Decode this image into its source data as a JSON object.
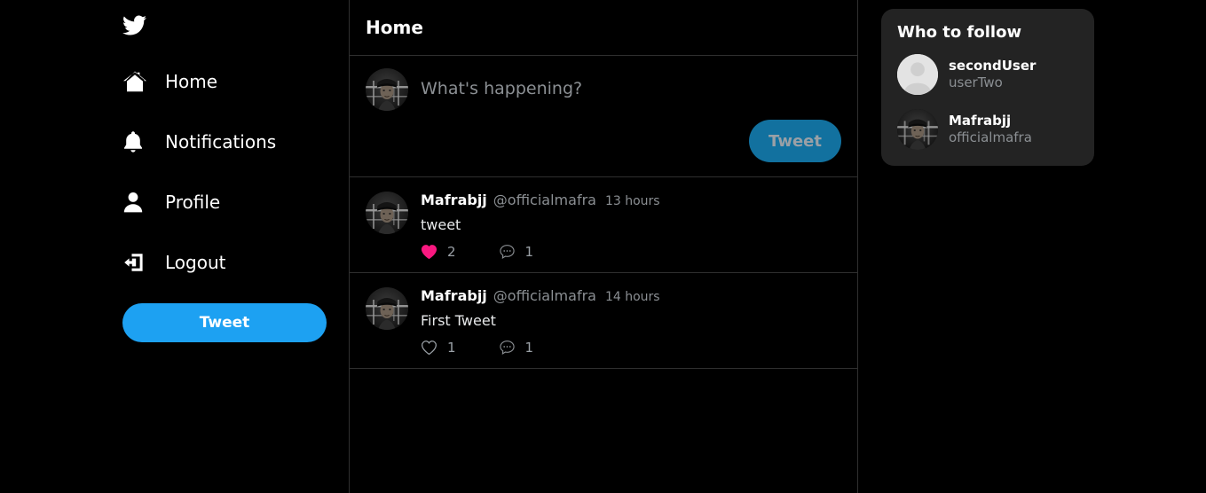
{
  "brand": {
    "logo_icon": "twitter-bird-icon"
  },
  "sidebar": {
    "items": [
      {
        "label": "Home",
        "icon": "home-icon"
      },
      {
        "label": "Notifications",
        "icon": "bell-icon"
      },
      {
        "label": "Profile",
        "icon": "person-icon"
      },
      {
        "label": "Logout",
        "icon": "logout-icon"
      }
    ],
    "tweet_button": "Tweet"
  },
  "feed": {
    "title": "Home",
    "composer": {
      "placeholder": "What's happening?",
      "value": "",
      "submit_label": "Tweet",
      "avatar_icon": "user-avatar-photo"
    },
    "tweets": [
      {
        "name": "Mafrabjj",
        "handle": "@officialmafra",
        "time": "13 hours",
        "text": "tweet",
        "like_count": "2",
        "liked": true,
        "comment_count": "1",
        "avatar_icon": "user-avatar-photo"
      },
      {
        "name": "Mafrabjj",
        "handle": "@officialmafra",
        "time": "14 hours",
        "text": "First Tweet",
        "like_count": "1",
        "liked": false,
        "comment_count": "1",
        "avatar_icon": "user-avatar-photo"
      }
    ]
  },
  "who_to_follow": {
    "title": "Who to follow",
    "people": [
      {
        "name": "secondUser",
        "handle": "userTwo",
        "avatar_icon": "default-avatar-icon"
      },
      {
        "name": "Mafrabjj",
        "handle": "officialmafra",
        "avatar_icon": "user-avatar-photo"
      }
    ]
  },
  "colors": {
    "accent": "#1DA1F2",
    "accent_muted": "#12719F",
    "like_active": "#E0245E",
    "background": "#000000",
    "card": "#232323",
    "border": "#2F2F2F",
    "muted_text": "#8B8F93"
  }
}
